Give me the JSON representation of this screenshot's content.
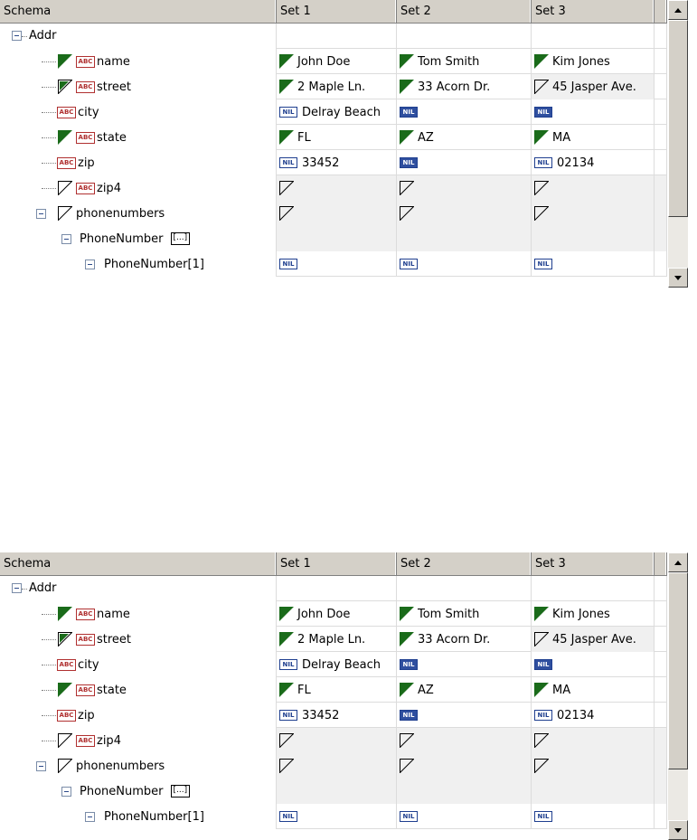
{
  "columns": [
    "Schema",
    "Set 1",
    "Set 2",
    "Set 3"
  ],
  "tree": {
    "root": "Addr",
    "fields": {
      "name": "name",
      "street": "street",
      "city": "city",
      "state": "state",
      "zip": "zip",
      "zip4": "zip4",
      "phonenumbers": "phonenumbers",
      "phonenumber": "PhoneNumber",
      "phonenumber_ellipsis": "[...]",
      "phonenumber1": "PhoneNumber[1]"
    }
  },
  "values": {
    "name": [
      "John Doe",
      "Tom Smith",
      "Kim Jones"
    ],
    "street": [
      "2 Maple Ln.",
      "33 Acorn Dr.",
      "45 Jasper Ave."
    ],
    "city": [
      "Delray Beach",
      "",
      ""
    ],
    "state": [
      "FL",
      "AZ",
      "MA"
    ],
    "zip": [
      "33452",
      "",
      "02134"
    ]
  },
  "badges": {
    "nil": "NIL",
    "abc": "ABC"
  },
  "icons": {
    "expander": "collapse-minus-icon",
    "filled_triangle": "green-flag-triangle-icon",
    "empty_triangle": "empty-flag-triangle-icon",
    "half_triangle": "partial-flag-triangle-icon",
    "string_type": "abc-string-type-icon",
    "nil": "nil-value-icon"
  },
  "colors": {
    "header_bg": "#d4d0c8",
    "flag_green": "#1a6b1a",
    "nil_blue": "#2f4f9f",
    "abc_red": "#b03030",
    "alt_row": "#f0f0f0"
  }
}
